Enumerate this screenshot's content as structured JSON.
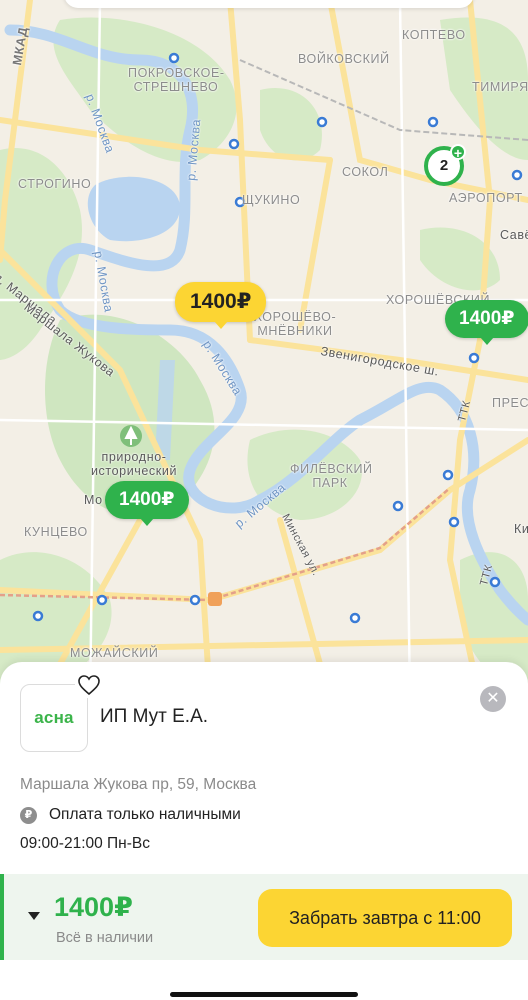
{
  "map": {
    "labels": {
      "koptevo": "КОПТЕВО",
      "voikovsky": "ВОЙКОВСКИЙ",
      "pokrovskoe_1": "ПОКРОВСКОЕ-",
      "pokrovskoe_2": "СТРЕШНЕВО",
      "timiryazevsky": "ТИМИРЯЗ",
      "mkad": "МКАД",
      "strogino": "СТРОГИНО",
      "shchukino": "ЩУКИНО",
      "sokol": "СОКОЛ",
      "aeroport": "АЭРОПОРТ",
      "savyolovsky": "Савё",
      "khoroshevsky": "ХОРОШЁВСКИЙ",
      "khoroshevo_1": "ХОРОШЁВО-",
      "khoroshevo_2": "МНЁВНИКИ",
      "marshal_zhukov": "Маршала Жукова",
      "marshal_zhukov_prefix": "п. Маршала",
      "zvenigorodskoe": "Звенигородское ш.",
      "moskva_river_1": "р. Москва",
      "moskva_river_2": "р. Москва",
      "moskva_river_3": "р. Москва",
      "moskva_river_4": "р. Москва",
      "moskva_river_5": "р. Москва",
      "presnya": "ПРЕС",
      "ttk_1": "ТТК",
      "ttk_2": "ТТК",
      "park_1": "природно-",
      "park_2": "исторический",
      "fili_1": "ФИЛЁВСКИЙ",
      "fili_2": "ПАРК",
      "mo": "Мо",
      "kuntsevo": "КУНЦЕВО",
      "minskaya": "Минская ул.",
      "mozhaisky": "МОЖАЙСКИЙ",
      "ki": "Ки"
    },
    "pins": {
      "selected_price": "1400₽",
      "pin_east_price": "1400₽",
      "pin_west_price": "1400₽"
    },
    "cluster": {
      "count": "2",
      "plus": "+"
    }
  },
  "sheet": {
    "logo_text": "асна",
    "store_name": "ИП Мут Е.А.",
    "address": "Маршала Жукова пр, 59, Москва",
    "payment_icon": "₽",
    "payment_text": "Оплата только наличными",
    "hours": "09:00-21:00 Пн-Вс",
    "close_icon": "✕",
    "action": {
      "price": "1400₽",
      "stock": "Всё в наличии",
      "pickup_button": "Забрать завтра с 11:00"
    }
  },
  "colors": {
    "accent_green": "#2fb24c",
    "accent_yellow": "#fcd533",
    "water": "#bcd6f2",
    "park": "#cfe6c0"
  }
}
